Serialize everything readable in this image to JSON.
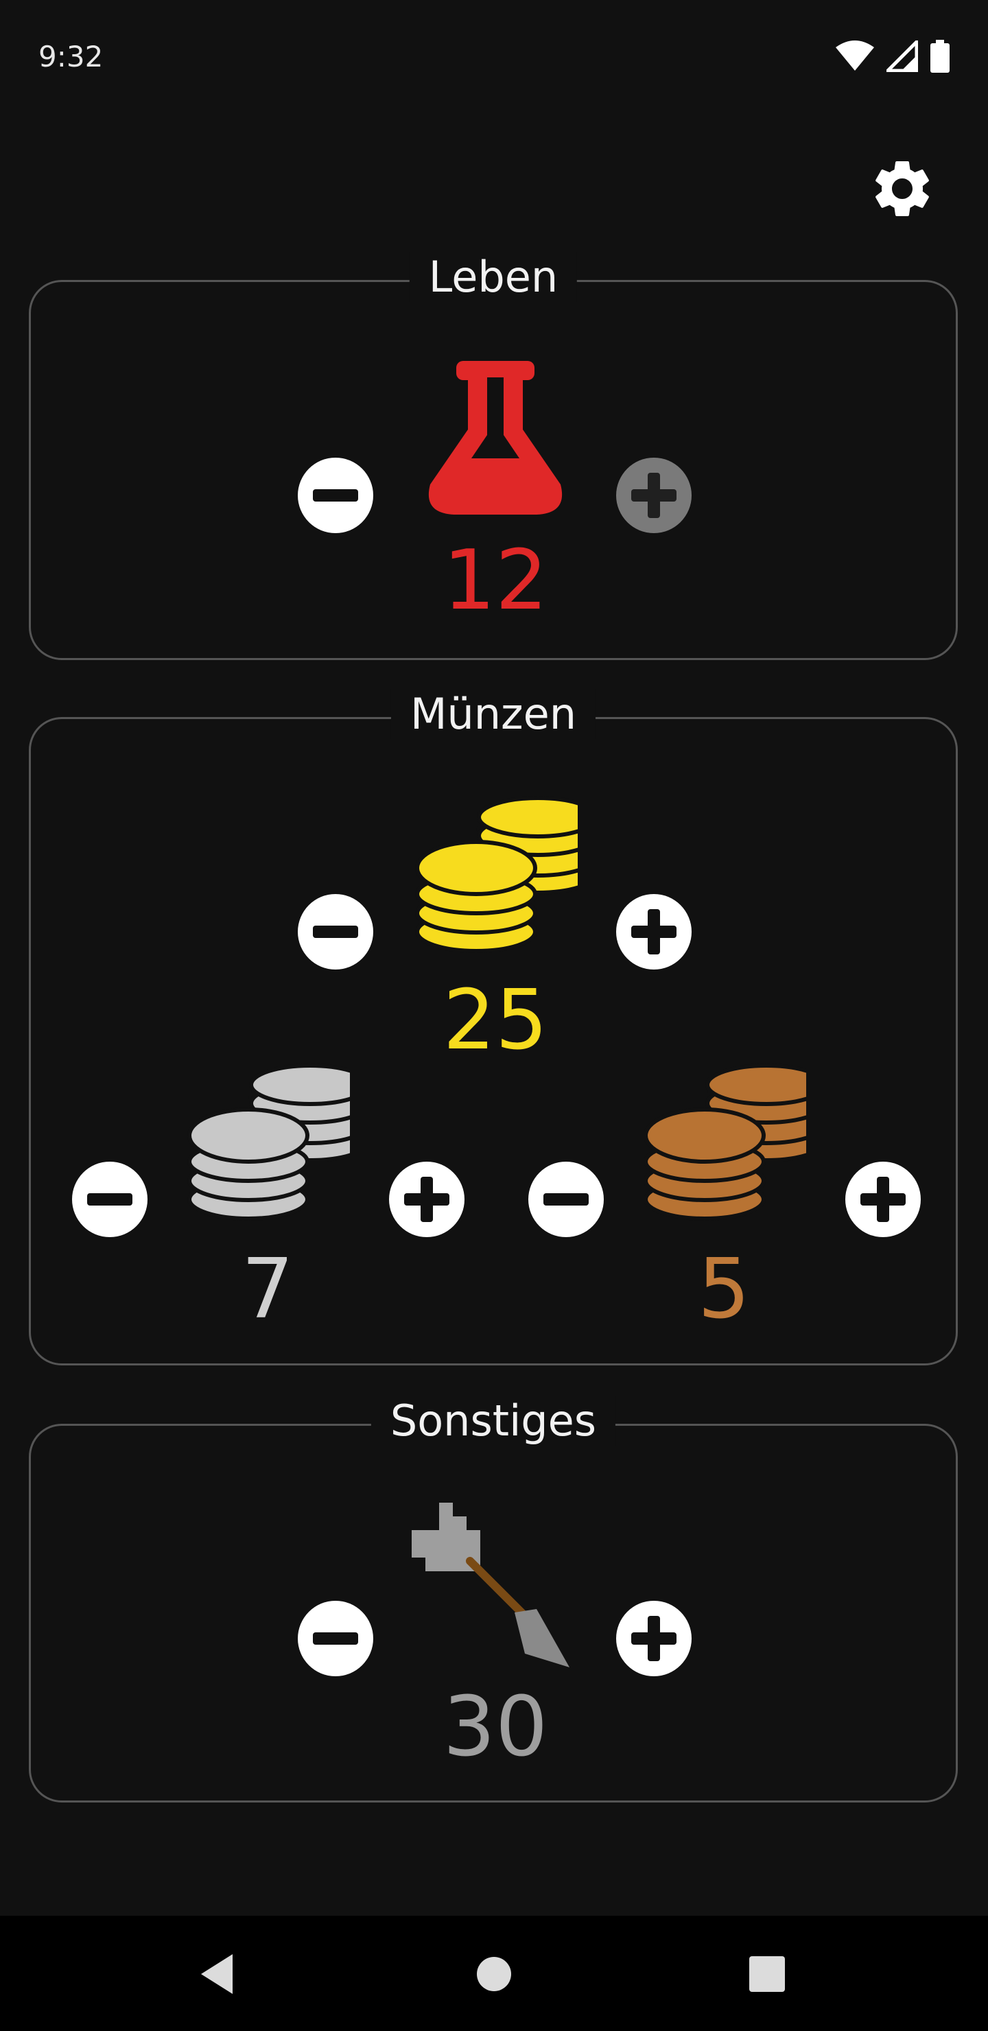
{
  "status_bar": {
    "time": "9:32"
  },
  "sections": {
    "leben": {
      "title": "Leben",
      "value": "12",
      "color": "#e02828"
    },
    "muenzen": {
      "title": "Münzen",
      "gold": {
        "value": "25",
        "color": "#f7dc1e"
      },
      "silver": {
        "value": "7",
        "color": "#d0d0d0"
      },
      "copper": {
        "value": "5",
        "color": "#c07a3a"
      }
    },
    "sonstiges": {
      "title": "Sonstiges",
      "value": "30",
      "color": "#9e9e9e"
    }
  },
  "icons": {
    "settings": "gear-icon",
    "leben": "flask-icon",
    "coins": "coin-stack-icon",
    "sonstiges": "arrow-icon"
  }
}
